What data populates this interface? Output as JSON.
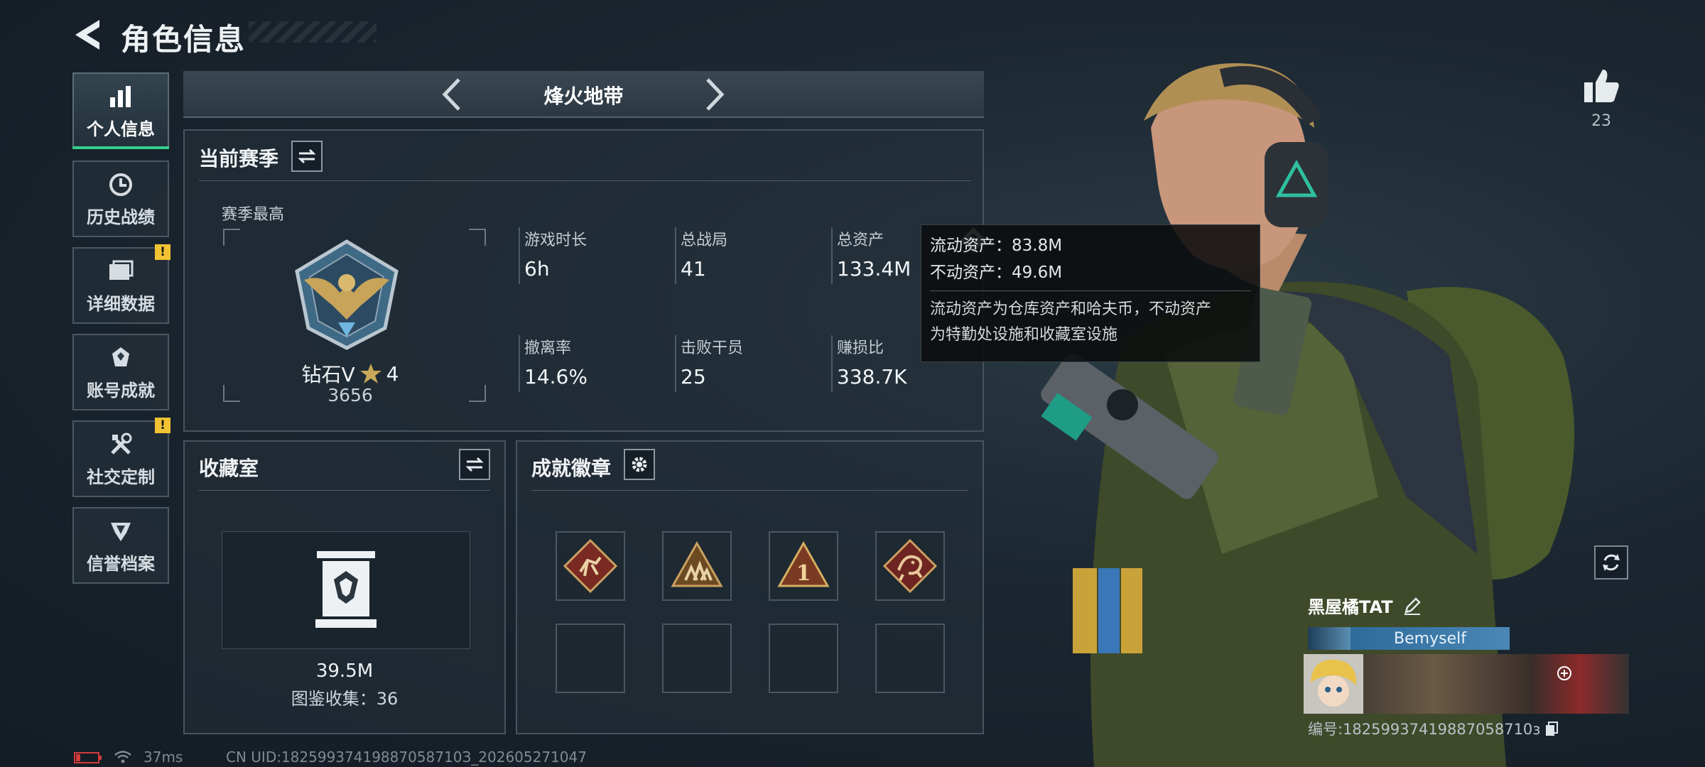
{
  "header": {
    "title": "角色信息"
  },
  "nav": {
    "items": [
      {
        "label": "个人信息",
        "icon": "bar-chart-icon",
        "active": true,
        "alert": false
      },
      {
        "label": "历史战绩",
        "icon": "history-icon",
        "active": false,
        "alert": false
      },
      {
        "label": "详细数据",
        "icon": "folder-icon",
        "active": false,
        "alert": true
      },
      {
        "label": "账号成就",
        "icon": "achievement-icon",
        "active": false,
        "alert": false
      },
      {
        "label": "社交定制",
        "icon": "tools-icon",
        "active": false,
        "alert": true
      },
      {
        "label": "信誉档案",
        "icon": "reputation-icon",
        "active": false,
        "alert": false
      }
    ],
    "alert_mark": "!"
  },
  "mode": {
    "label": "烽火地带"
  },
  "season": {
    "title": "当前赛季",
    "best_label": "赛季最高",
    "rank_name": "钻石V",
    "rank_stars": "4",
    "rank_score": "3656",
    "stats": [
      {
        "label": "游戏时长",
        "value": "6h"
      },
      {
        "label": "总战局",
        "value": "41"
      },
      {
        "label": "总资产",
        "value": "133.4M"
      },
      {
        "label": "撤离率",
        "value": "14.6%"
      },
      {
        "label": "击败干员",
        "value": "25"
      },
      {
        "label": "赚损比",
        "value": "338.7K"
      }
    ]
  },
  "tooltip": {
    "liquid": "流动资产：83.8M",
    "fixed": "不动资产：49.6M",
    "desc_line1": "流动资产为仓库资产和哈夫币，不动资产",
    "desc_line2": "为特勤处设施和收藏室设施"
  },
  "collection": {
    "title": "收藏室",
    "value": "39.5M",
    "count_text": "图鉴收集：36"
  },
  "achievements": {
    "title": "成就徽章",
    "badges": [
      "runner-badge-icon",
      "team-badge-icon",
      "number-one-badge-icon",
      "dragon-badge-icon"
    ]
  },
  "social": {
    "likes": "23"
  },
  "profile": {
    "name": "黑屋橘TAT",
    "tag": "Bemyself",
    "uid_text": "编号:18259937419887058710з"
  },
  "status_bar": {
    "ping": "37ms",
    "uid": "CN UID:18259937419887058710З_202605271047"
  },
  "colors": {
    "accent_green": "#37d08a",
    "alert_yellow": "#f1c232",
    "tag_blue": "#3f7fb0"
  }
}
